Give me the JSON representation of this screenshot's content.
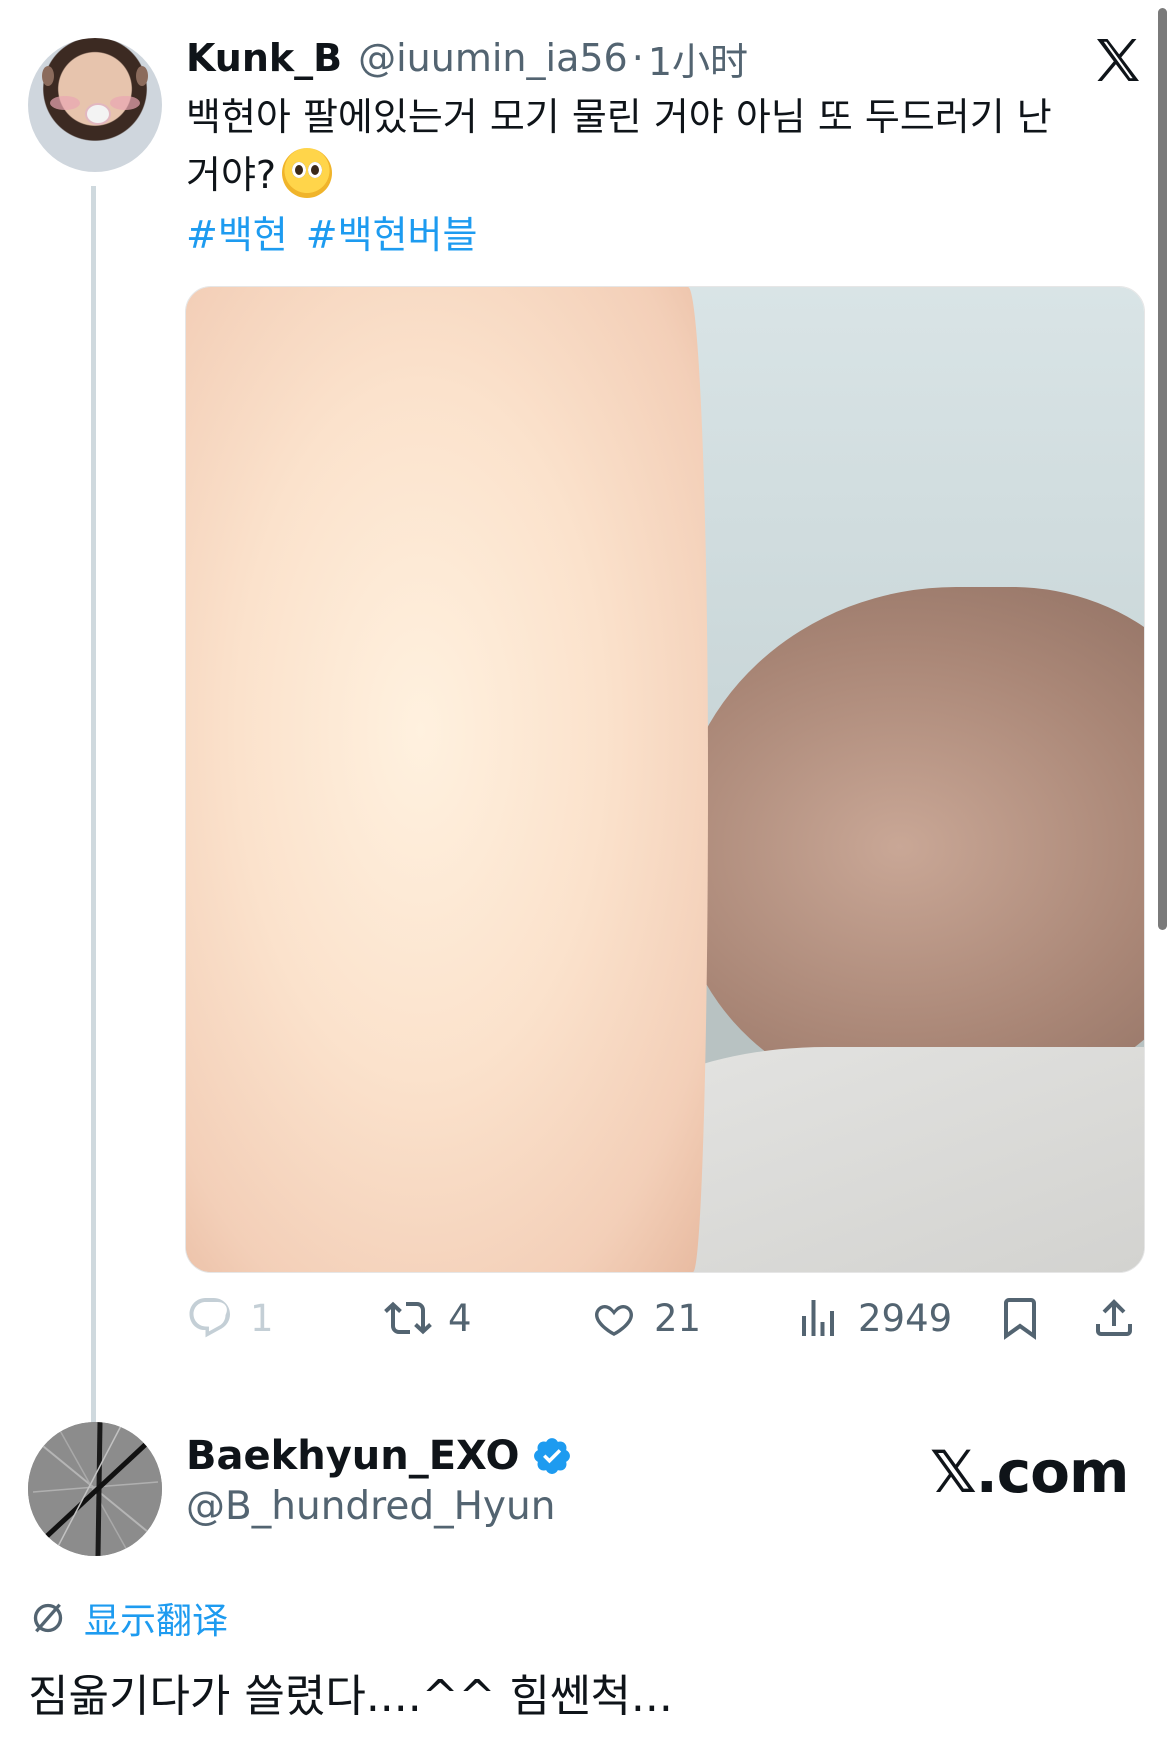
{
  "tweet": {
    "display_name": "Kunk_B",
    "handle": "@iuumin_ia56",
    "separator": "·",
    "time": "1小时",
    "text_line1": "백현아 팔에있는거 모기 물린 거야 아님 또 두드러기 난",
    "text_line2": "거야?",
    "emoji": "pleading-face-emoji",
    "hashtags": [
      "#백현",
      "#백현버블"
    ],
    "media_alt_icon": "photo-arm",
    "actions": {
      "reply_count": "1",
      "retweet_count": "4",
      "like_count": "21",
      "views_count": "2949"
    }
  },
  "reply": {
    "display_name": "Baekhyun_EXO",
    "handle": "@B_hundred_Hyun",
    "verified": true,
    "translate_label": "显示翻译",
    "text": "짐옮기다가 쓸렸다....^^ 힘쎈척..."
  },
  "branding": {
    "site": "𝕏.com"
  },
  "colors": {
    "link": "#1d9bf0",
    "secondary_text": "#536471",
    "thread_line": "#cfd9de",
    "verified": "#1d9bf0"
  }
}
